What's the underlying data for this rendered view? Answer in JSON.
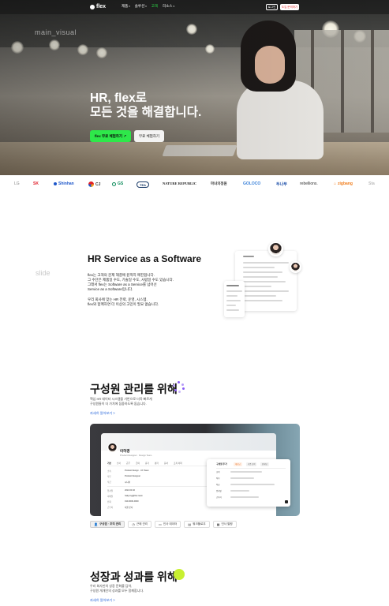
{
  "hero": {
    "watermark": "main_visual",
    "title_line1": "HR, flex로",
    "title_line2": "모든 것을 해결합니다.",
    "primary_button": "flex 무료 체험하기 ↗",
    "secondary_button": "무료 체험하기"
  },
  "nav": {
    "logo": "flex",
    "menu": [
      "제품",
      "솔루션",
      "고객",
      "리소스"
    ],
    "active_index": 2,
    "login": "로그인",
    "cta": "도입 문의하기",
    "accent": "#2ee84a"
  },
  "clients": [
    "LG",
    "SK",
    "Shinhan",
    "CJ",
    "GS",
    "TEA",
    "NATURE REPUBLIC",
    "마녀의정원",
    "GOLOCO",
    "두나무",
    "rebellions.",
    "zigbang",
    "Sta"
  ],
  "hr_service": {
    "watermark": "slide",
    "title": "HR Service as a Software",
    "p1": [
      "flex는 고객의 문제 해결에 끝까지 매진합니다.",
      "그 수단은 제품일 수도, 기술일 수도, 사람일 수도 있습니다.",
      "그래서 flex는 Software as a Service를 넘어선",
      "Service as a Software입니다."
    ],
    "p2": [
      "우리 회사에 맞는 HR 전략, 운영, 시스템.",
      "flex와 함께하면 더 이상의 고민이 필요 없습니다."
    ]
  },
  "members": {
    "title": "구성원 관리를 위해",
    "desc": [
      "핵심 HR 데이터 시스템을 기반으로 더욱 빠르게",
      "구성원들이 더 가치에 집중하도록 돕습니다."
    ],
    "more": "자세히 알아보기 >",
    "panel": {
      "name": "이하경",
      "sub": "Product Designer · Design Team",
      "tabs": [
        "기본",
        "인사",
        "근무",
        "급여",
        "휴가",
        "평가",
        "문서",
        "조직 이력"
      ],
      "rows": [
        {
          "label": "소속",
          "value": "Product Design · UX Team"
        },
        {
          "label": "직무",
          "value": "Product Designer"
        },
        {
          "label": "직급",
          "value": "시니어"
        },
        {
          "label": "입사일",
          "value": "2022.03.02"
        },
        {
          "label": "이메일",
          "value": "hakyung@flex.team"
        },
        {
          "label": "전화",
          "value": "010-0000-0000"
        },
        {
          "label": "근무지",
          "value": "서울 본사"
        }
      ],
      "float": {
        "title": "구성원 추가",
        "chips": [
          "대표님",
          "기존 조직",
          "인사팀"
        ],
        "rows": [
          "조직",
          "직무",
          "직급",
          "입사일",
          "근무지"
        ]
      }
    },
    "tabs": [
      {
        "icon": "user-icon",
        "label": "구성원 · 조직 관리"
      },
      {
        "icon": "time-icon",
        "label": "근태 관리"
      },
      {
        "icon": "chat-icon",
        "label": "인사 데이터"
      },
      {
        "icon": "doc-icon",
        "label": "워크플로우"
      },
      {
        "icon": "grid-icon",
        "label": "인사 발령"
      }
    ]
  },
  "growth": {
    "title": "성장과 성과를 위해",
    "desc": [
      "우리 회사만의 성장 문화를 담아,",
      "구성원 개개인의 성과를 모두 함께합니다."
    ],
    "more": "자세히 알아보기 >"
  }
}
